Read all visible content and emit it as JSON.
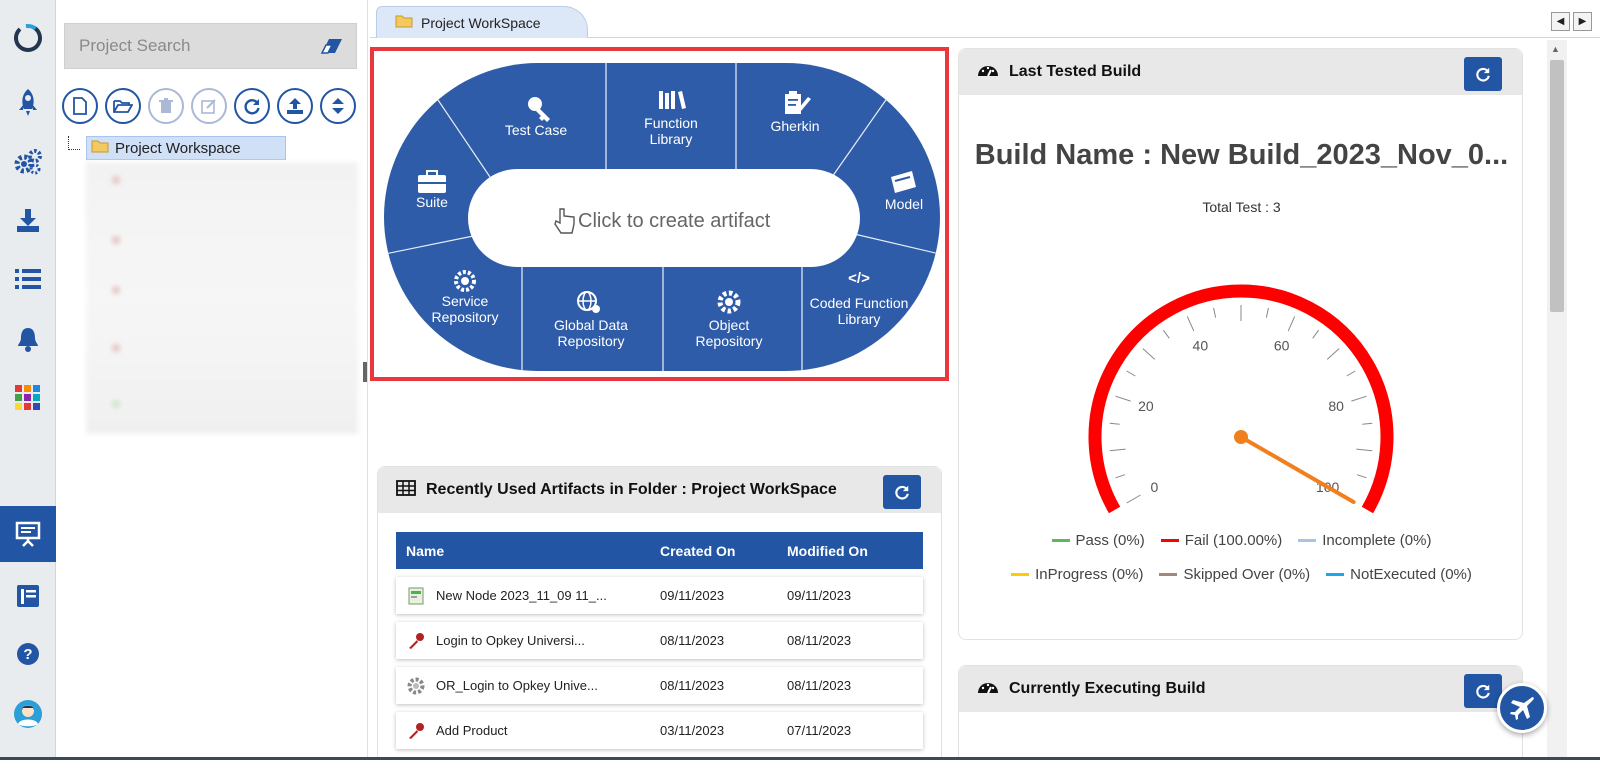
{
  "rail": {
    "items": [
      {
        "icon": "opkey-logo-icon"
      },
      {
        "icon": "rocket-icon"
      },
      {
        "icon": "gears-icon"
      },
      {
        "icon": "download-icon"
      },
      {
        "icon": "list-icon"
      },
      {
        "icon": "bell-icon"
      },
      {
        "icon": "apps-grid-icon"
      },
      {
        "icon": "presentation-icon",
        "active": true
      },
      {
        "icon": "report-icon"
      },
      {
        "icon": "help-icon"
      },
      {
        "icon": "user-avatar-icon"
      }
    ]
  },
  "tree": {
    "search_placeholder": "Project Search",
    "root_label": "Project Workspace"
  },
  "tabs": {
    "active_label": "Project WorkSpace"
  },
  "artifacts": {
    "center_prompt": "Click to create artifact",
    "segments": {
      "test_case": "Test Case",
      "function_library_1": "Function",
      "function_library_2": "Library",
      "gherkin": "Gherkin",
      "suite": "Suite",
      "model": "Model",
      "service_repo_1": "Service",
      "service_repo_2": "Repository",
      "global_data_1": "Global Data",
      "global_data_2": "Repository",
      "object_repo_1": "Object",
      "object_repo_2": "Repository",
      "coded_function_1": "Coded Function",
      "coded_function_2": "Library"
    }
  },
  "recent": {
    "title": "Recently Used Artifacts in Folder : Project WorkSpace",
    "columns": [
      "Name",
      "Created On",
      "Modified On"
    ],
    "rows": [
      {
        "name": "New Node 2023_11_09 11_...",
        "created": "09/11/2023",
        "modified": "09/11/2023",
        "icon": "test-node-icon"
      },
      {
        "name": "Login to Opkey Universi...",
        "created": "08/11/2023",
        "modified": "08/11/2023",
        "icon": "key-icon"
      },
      {
        "name": "OR_Login to Opkey Unive...",
        "created": "08/11/2023",
        "modified": "08/11/2023",
        "icon": "gear-icon"
      },
      {
        "name": "Add Product",
        "created": "03/11/2023",
        "modified": "07/11/2023",
        "icon": "key-icon"
      }
    ]
  },
  "last_tested": {
    "title": "Last Tested Build",
    "build_name": "Build Name : New Build_2023_Nov_0...",
    "total_test": "Total Test : 3",
    "gauge_value": 100,
    "gauge_labels": [
      "0",
      "20",
      "40",
      "60",
      "80",
      "100"
    ],
    "legend": [
      {
        "label": "Pass (0%)",
        "color": "#5cb85c"
      },
      {
        "label": "Fail (100.00%)",
        "color": "#ff0000"
      },
      {
        "label": "Incomplete (0%)",
        "color": "#a9c4e3"
      },
      {
        "label": "InProgress (0%)",
        "color": "#ffcc00"
      },
      {
        "label": "Skipped Over (0%)",
        "color": "#a1887f"
      },
      {
        "label": "NotExecuted (0%)",
        "color": "#1ea7e8"
      }
    ]
  },
  "currently_executing": {
    "title": "Currently Executing Build"
  },
  "colors": {
    "brand": "#2255a4",
    "highlight_border": "#e8373d",
    "gauge_needle": "#f07f1e"
  }
}
